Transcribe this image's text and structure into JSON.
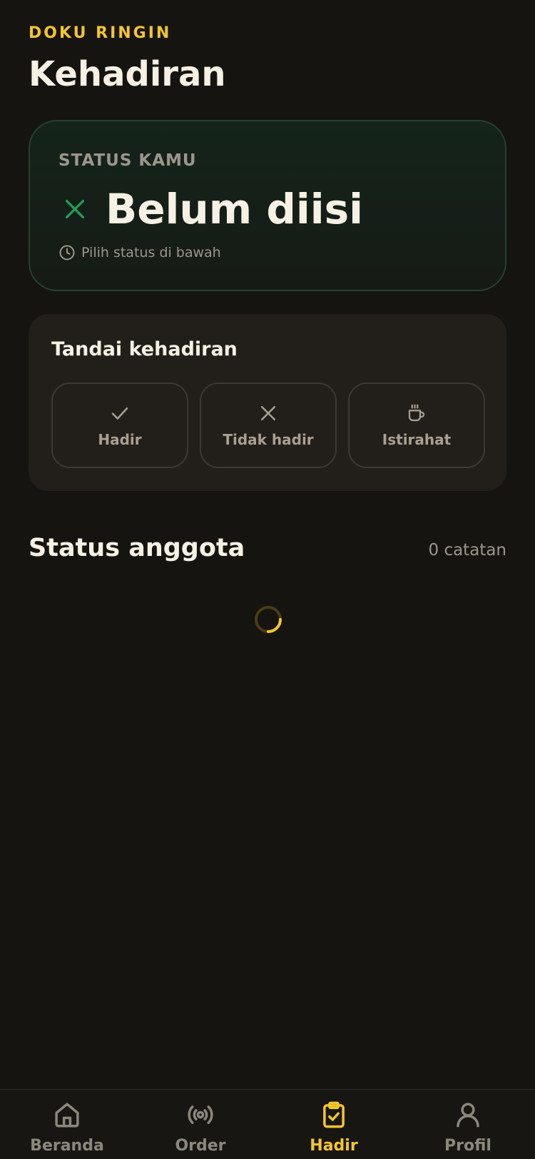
{
  "header": {
    "brand": "DOKU RINGIN",
    "title": "Kehadiran"
  },
  "status_card": {
    "label": "STATUS KAMU",
    "value": "Belum diisi",
    "hint": "Pilih status di bawah",
    "icon": "x-icon",
    "accent": "#1f9d55"
  },
  "mark_card": {
    "title": "Tandai kehadiran",
    "options": [
      {
        "label": "Hadir",
        "icon": "check-icon"
      },
      {
        "label": "Tidak hadir",
        "icon": "x-icon"
      },
      {
        "label": "Istirahat",
        "icon": "coffee-icon"
      }
    ]
  },
  "members": {
    "title": "Status anggota",
    "count": "0 catatan",
    "loading": true
  },
  "nav": {
    "items": [
      {
        "label": "Beranda",
        "icon": "home-icon",
        "active": false
      },
      {
        "label": "Order",
        "icon": "broadcast-icon",
        "active": false
      },
      {
        "label": "Hadir",
        "icon": "clipboard-check-icon",
        "active": true
      },
      {
        "label": "Profil",
        "icon": "user-icon",
        "active": false
      }
    ],
    "active_color": "#f5c52d"
  }
}
